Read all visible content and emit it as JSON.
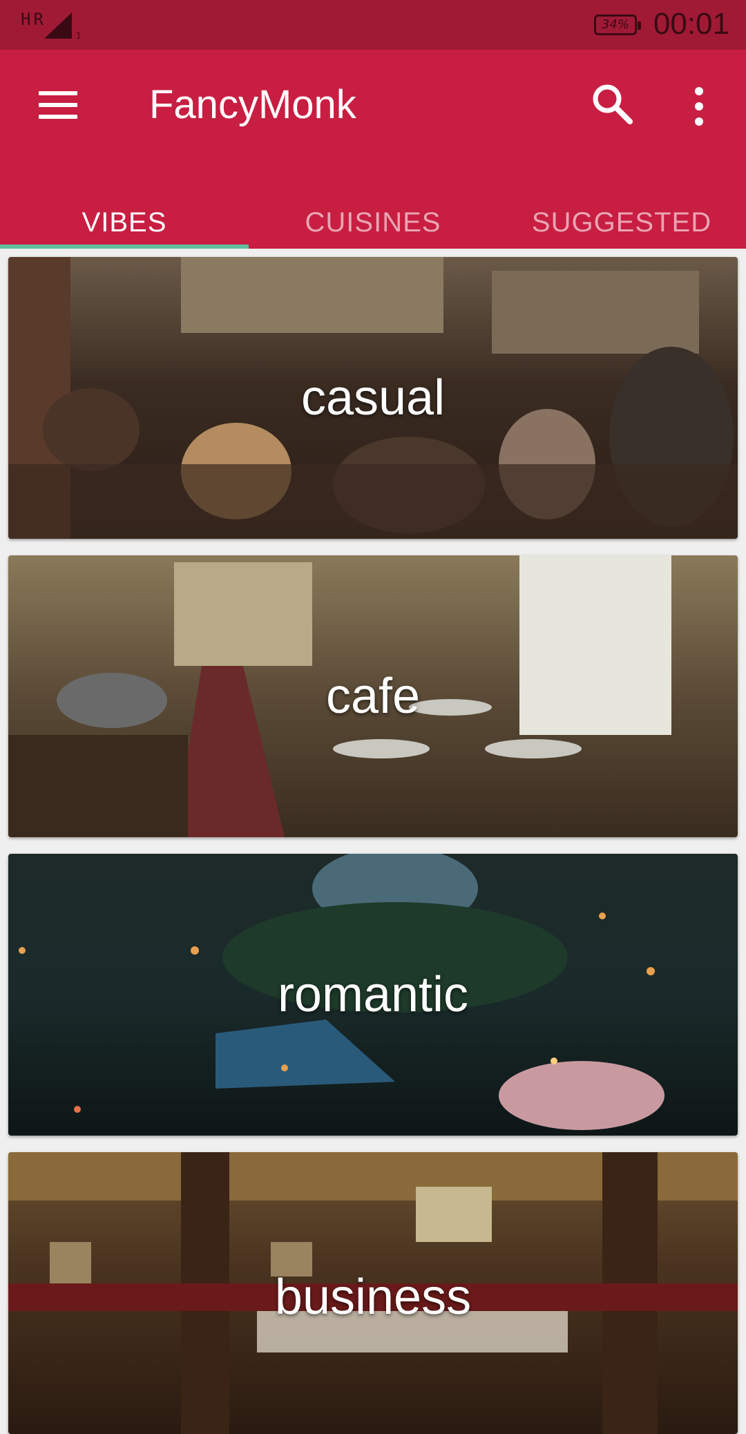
{
  "status_bar": {
    "carrier": "HR",
    "sim_slot": "1",
    "battery": "34%",
    "time": "00:01"
  },
  "app_bar": {
    "title": "FancyMonk",
    "menu_icon": "hamburger-menu-icon",
    "search_icon": "search-icon",
    "more_icon": "more-vert-icon"
  },
  "tabs": [
    {
      "label": "VIBES",
      "active": true
    },
    {
      "label": "CUISINES",
      "active": false
    },
    {
      "label": "SUGGESTED",
      "active": false
    }
  ],
  "colors": {
    "status_bar": "#a01a35",
    "app_bar": "#c81e42",
    "tab_indicator": "#5fbfa0"
  },
  "vibes": [
    {
      "label": "casual"
    },
    {
      "label": "cafe"
    },
    {
      "label": "romantic"
    },
    {
      "label": "business"
    }
  ]
}
